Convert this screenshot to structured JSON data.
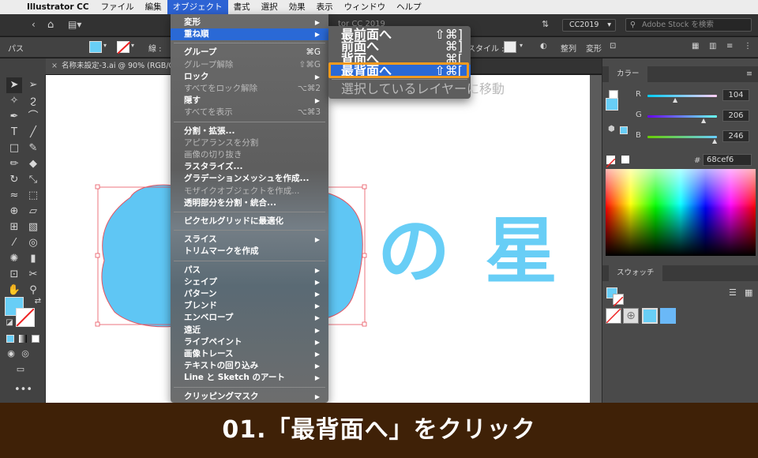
{
  "menubar": {
    "apple_icon": "apple-icon",
    "app_name": "Illustrator CC",
    "items": [
      "ファイル",
      "編集",
      "オブジェクト",
      "書式",
      "選択",
      "効果",
      "表示",
      "ウィンドウ",
      "ヘルプ"
    ],
    "active_item": "オブジェクト"
  },
  "appbar": {
    "title_fragment": "tor CC 2019",
    "workspace": "CC2019",
    "search_placeholder": "Adobe Stock を検索"
  },
  "control_bar": {
    "path_label": "パス",
    "stroke_label": "線 :",
    "style_label": "スタイル :",
    "align_label": "整列",
    "transform_label": "変形"
  },
  "document_tab": {
    "label": "名称未設定-3.ai @ 90% (RGB/GPU プレビュー)"
  },
  "artboard": {
    "text": "の 星",
    "fill_color": "#68cef6",
    "cloud_color": "#5fc6f4",
    "selection_color": "#e8535f"
  },
  "object_menu": {
    "groups": [
      [
        {
          "label": "変形",
          "arrow": true
        },
        {
          "label": "重ね順",
          "arrow": true,
          "highlighted": true
        }
      ],
      [
        {
          "label": "グループ",
          "shortcut": "⌘G"
        },
        {
          "label": "グループ解除",
          "shortcut": "⇧⌘G",
          "disabled": true
        },
        {
          "label": "ロック",
          "arrow": true
        },
        {
          "label": "すべてをロック解除",
          "shortcut": "⌥⌘2",
          "disabled": true
        },
        {
          "label": "隠す",
          "arrow": true
        },
        {
          "label": "すべてを表示",
          "shortcut": "⌥⌘3",
          "disabled": true
        }
      ],
      [
        {
          "label": "分割・拡張..."
        },
        {
          "label": "アピアランスを分割",
          "disabled": true
        },
        {
          "label": "画像の切り抜き",
          "disabled": true
        },
        {
          "label": "ラスタライズ..."
        },
        {
          "label": "グラデーションメッシュを作成..."
        },
        {
          "label": "モザイクオブジェクトを作成...",
          "disabled": true
        },
        {
          "label": "透明部分を分割・統合..."
        }
      ],
      [
        {
          "label": "ピクセルグリッドに最適化"
        }
      ],
      [
        {
          "label": "スライス",
          "arrow": true
        },
        {
          "label": "トリムマークを作成"
        }
      ],
      [
        {
          "label": "パス",
          "arrow": true
        },
        {
          "label": "シェイプ",
          "arrow": true
        },
        {
          "label": "パターン",
          "arrow": true
        },
        {
          "label": "ブレンド",
          "arrow": true
        },
        {
          "label": "エンベロープ",
          "arrow": true
        },
        {
          "label": "遠近",
          "arrow": true
        },
        {
          "label": "ライブペイント",
          "arrow": true
        },
        {
          "label": "画像トレース",
          "arrow": true
        },
        {
          "label": "テキストの回り込み",
          "arrow": true
        },
        {
          "label": "Line と Sketch のアート",
          "arrow": true
        }
      ],
      [
        {
          "label": "クリッピングマスク",
          "arrow": true
        }
      ]
    ]
  },
  "arrange_submenu": {
    "items": [
      {
        "label": "最前面へ",
        "shortcut": "⇧⌘]"
      },
      {
        "label": "前面へ",
        "shortcut": "⌘]"
      },
      {
        "label": "背面へ",
        "shortcut": "⌘["
      },
      {
        "label": "最背面へ",
        "shortcut": "⇧⌘[",
        "highlighted": true
      },
      {
        "label": "選択しているレイヤーに移動",
        "disabled": true
      }
    ]
  },
  "color_panel": {
    "title": "カラー",
    "r_label": "R",
    "r_value": "104",
    "g_label": "G",
    "g_value": "206",
    "b_label": "B",
    "b_value": "246",
    "hex_label": "#",
    "hex_value": "68cef6",
    "swatch_color": "#68cef6"
  },
  "swatch_panel": {
    "title": "スウォッチ"
  },
  "caption": {
    "text": "01.「最背面へ」をクリック"
  }
}
